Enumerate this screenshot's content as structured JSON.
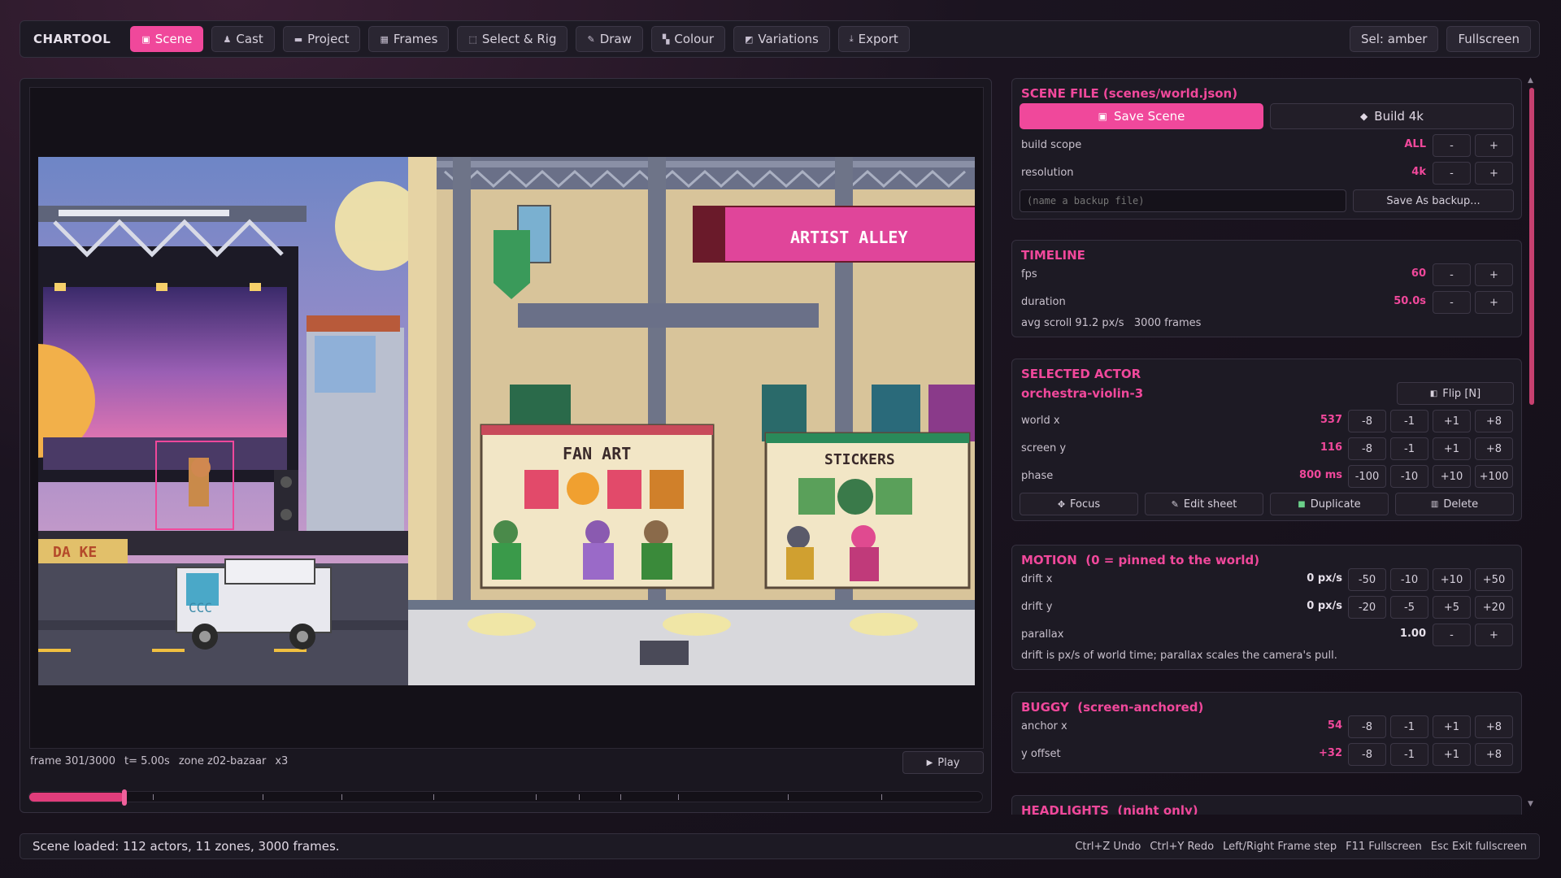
{
  "app": {
    "name": "CHARTOOL"
  },
  "toolbar": {
    "tabs": [
      {
        "label": "Scene",
        "icon": "scene-icon",
        "active": true
      },
      {
        "label": "Cast",
        "icon": "cast-icon"
      },
      {
        "label": "Project",
        "icon": "folder-icon"
      },
      {
        "label": "Frames",
        "icon": "frames-icon"
      },
      {
        "label": "Select & Rig",
        "icon": "select-icon"
      },
      {
        "label": "Draw",
        "icon": "pencil-icon"
      },
      {
        "label": "Colour",
        "icon": "palette-icon"
      },
      {
        "label": "Variations",
        "icon": "variations-icon"
      },
      {
        "label": "Export",
        "icon": "export-icon"
      }
    ],
    "selection": "Sel: amber",
    "fullscreen": "Fullscreen"
  },
  "scene": {
    "signs": {
      "banner": "ARTIST ALLEY",
      "stall1": "FAN ART",
      "stall2": "STICKERS",
      "marquee": "DA KE",
      "van": "CCC"
    }
  },
  "stage_info": {
    "frame": "frame 301/3000",
    "time": "t= 5.00s",
    "zone": "zone z02-bazaar",
    "scale": "x3",
    "play_label": "Play",
    "progress": 0.1
  },
  "scene_file": {
    "title": "SCENE FILE  (scenes/world.json)",
    "save_label": "Save Scene",
    "build_label": "Build 4k",
    "build_scope_label": "build scope",
    "build_scope_value": "ALL",
    "resolution_label": "resolution",
    "resolution_value": "4k",
    "minus": "-",
    "plus": "+",
    "backup_placeholder": "(name a backup file)",
    "save_as_label": "Save As backup..."
  },
  "timeline": {
    "title": "TIMELINE",
    "fps_label": "fps",
    "fps_value": "60",
    "duration_label": "duration",
    "duration_value": "50.0s",
    "note": "avg scroll 91.2 px/s   3000 frames"
  },
  "actor": {
    "title": "SELECTED ACTOR",
    "name": "orchestra-violin-3",
    "flip_label": "Flip [N]",
    "world_x_label": "world x",
    "world_x_value": "537",
    "screen_y_label": "screen y",
    "screen_y_value": "116",
    "phase_label": "phase",
    "phase_value": "800 ms",
    "steps8": [
      "-8",
      "-1",
      "+1",
      "+8"
    ],
    "steps100": [
      "-100",
      "-10",
      "+10",
      "+100"
    ],
    "focus_label": "Focus",
    "edit_label": "Edit sheet",
    "duplicate_label": "Duplicate",
    "delete_label": "Delete"
  },
  "motion": {
    "title": "MOTION  (0 = pinned to the world)",
    "drift_x_label": "drift x",
    "drift_x_value": "0 px/s",
    "drift_x_steps": [
      "-50",
      "-10",
      "+10",
      "+50"
    ],
    "drift_y_label": "drift y",
    "drift_y_value": "0 px/s",
    "drift_y_steps": [
      "-20",
      "-5",
      "+5",
      "+20"
    ],
    "parallax_label": "parallax",
    "parallax_value": "1.00",
    "note": "drift is px/s of world time; parallax scales the camera's pull."
  },
  "buggy": {
    "title": "BUGGY  (screen-anchored)",
    "anchor_label": "anchor x",
    "anchor_value": "54",
    "yoff_label": "y offset",
    "yoff_value": "+32"
  },
  "headlights": {
    "title": "HEADLIGHTS  (night only)"
  },
  "status": {
    "message": "Scene loaded: 112 actors, 11 zones, 3000 frames.",
    "shortcuts": [
      "Ctrl+Z Undo",
      "Ctrl+Y Redo",
      "Left/Right Frame step",
      "F11 Fullscreen",
      "Esc Exit fullscreen"
    ]
  },
  "colors": {
    "accent": "#f0489b",
    "panel": "#1d1a24",
    "bg": "#140f18"
  }
}
